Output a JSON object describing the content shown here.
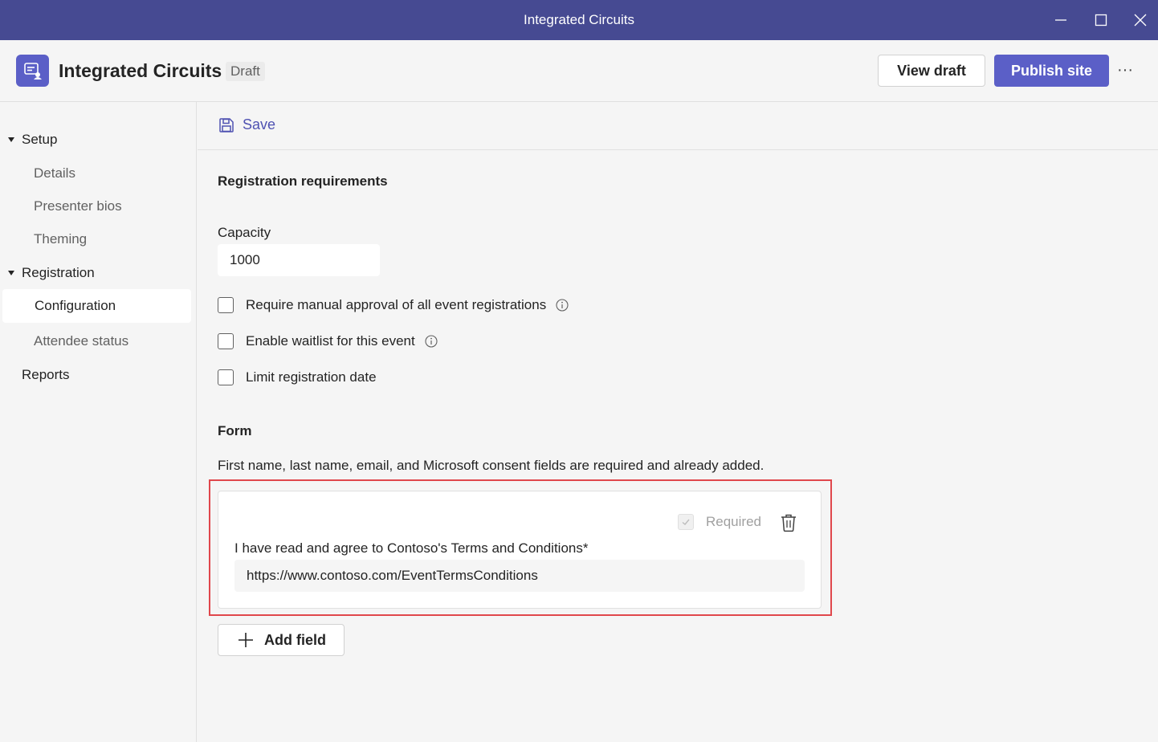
{
  "window": {
    "title": "Integrated Circuits"
  },
  "header": {
    "app_name": "Integrated Circuits",
    "status_badge": "Draft",
    "view_draft_label": "View draft",
    "publish_label": "Publish site",
    "more_label": "···"
  },
  "sidebar": {
    "groups": [
      {
        "label": "Setup",
        "items": [
          "Details",
          "Presenter bios",
          "Theming"
        ]
      },
      {
        "label": "Registration",
        "items": [
          "Configuration",
          "Attendee status"
        ]
      }
    ],
    "selected_item": "Configuration",
    "reports_label": "Reports"
  },
  "toolbar": {
    "save_label": "Save"
  },
  "registration": {
    "section_title": "Registration requirements",
    "capacity_label": "Capacity",
    "capacity_value": "1000",
    "options": [
      {
        "label": "Require manual approval of all event registrations",
        "checked": false,
        "has_info": true
      },
      {
        "label": "Enable waitlist for this event",
        "checked": false,
        "has_info": true
      },
      {
        "label": "Limit registration date",
        "checked": false,
        "has_info": false
      }
    ]
  },
  "form": {
    "section_title": "Form",
    "description": "First name, last name, email, and Microsoft consent fields are required and already added.",
    "custom_field": {
      "required_label": "Required",
      "required_checked": true,
      "question": "I have read and agree to Contoso's Terms and Conditions*",
      "url_value": "https://www.contoso.com/EventTermsConditions"
    },
    "add_field_label": "Add field"
  },
  "colors": {
    "titlebar": "#464a92",
    "accent": "#5b5fc7",
    "highlight": "#e0474c"
  }
}
